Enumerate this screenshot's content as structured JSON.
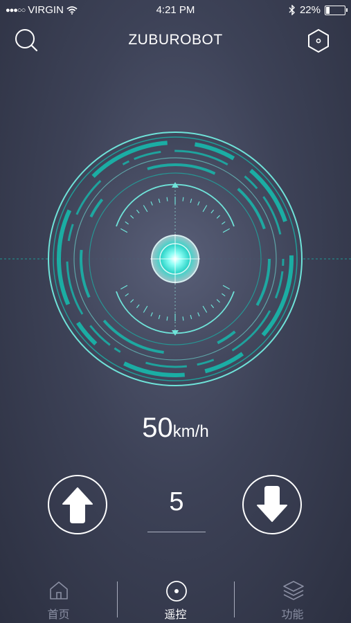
{
  "status_bar": {
    "signal_dots": "●●●○○",
    "carrier": "VIRGIN",
    "time": "4:21 PM",
    "battery_percent": "22%",
    "battery_level": 0.22
  },
  "nav": {
    "title": "ZUBUROBOT",
    "search_icon": "search-icon",
    "settings_icon": "hexagon-settings-icon"
  },
  "speed": {
    "value": "50",
    "unit": "km/h"
  },
  "controls": {
    "level_value": "5",
    "up_icon": "arrow-up-icon",
    "down_icon": "arrow-down-icon"
  },
  "tabs": [
    {
      "label": "首页",
      "icon": "home-icon",
      "active": false
    },
    {
      "label": "遥控",
      "icon": "target-circle-icon",
      "active": true
    },
    {
      "label": "功能",
      "icon": "layers-icon",
      "active": false
    }
  ],
  "colors": {
    "accent": "#19b3a8",
    "glow": "#6ff5ec",
    "background": "#3d4257"
  }
}
